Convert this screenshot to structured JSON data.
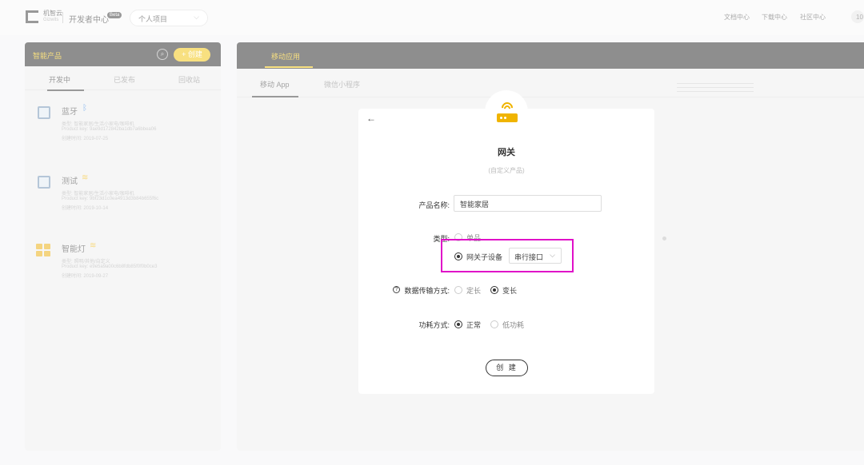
{
  "topbar": {
    "logo_text": "机智云",
    "logo_sub": "Gizwits",
    "dev_center": "开发者中心",
    "beta": "Beta",
    "project": "个人项目",
    "links": [
      "文档中心",
      "下载中心",
      "社区中心"
    ],
    "user": "10"
  },
  "sidebar": {
    "title": "智能产品",
    "create_label": "+ 创建",
    "tabs": [
      "开发中",
      "已发布",
      "回收站"
    ],
    "products": [
      {
        "name": "蓝牙",
        "symbol": "ᛒ",
        "symbol_color": "#2a7de1",
        "category": "类型: 智能家居/生活小家电/咖啡机",
        "product_key": "Product key: 9ae9d172842ba1db7a6bbea06",
        "created": "创建时间: 2019-07-25"
      },
      {
        "name": "测试",
        "symbol": "≋",
        "symbol_color": "#f0b400",
        "category": "类型: 智能家居/生活小家电/咖啡机",
        "product_key": "Product key: 9bf23d1c0ea4913d3b84b655f6c",
        "created": "创建时间: 2019-10-14"
      },
      {
        "name": "智能灯",
        "symbol": "≋",
        "symbol_color": "#f0b400",
        "category": "类型: 照明/其他/自定义",
        "product_key": "Product key: e9e5a9a00c6b8fdb85f0f0b0ce3",
        "created": "创建时间: 2019-09-27"
      }
    ]
  },
  "main": {
    "tab": "移动应用",
    "subtabs": [
      "移动 App",
      "微信小程序"
    ]
  },
  "modal": {
    "title": "网关",
    "subtitle": "(自定义产品)",
    "name_label": "产品名称:",
    "name_value": "智能家居",
    "type_label": "类型:",
    "type_options": [
      "单品",
      "网关子设备"
    ],
    "interface_value": "串行接口",
    "transfer_label": "数据传输方式:",
    "transfer_options": [
      "定长",
      "变长"
    ],
    "power_label": "功耗方式:",
    "power_options": [
      "正常",
      "低功耗"
    ],
    "submit": "创 建"
  }
}
